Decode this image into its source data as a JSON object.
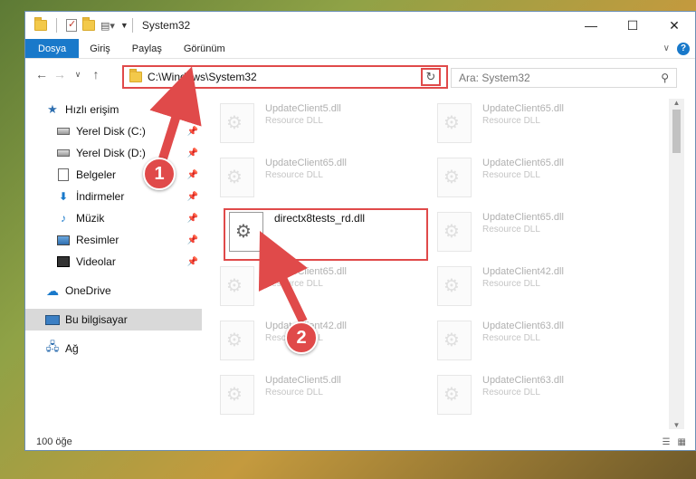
{
  "window": {
    "title": "System32"
  },
  "ribbon": {
    "tabs": [
      "Dosya",
      "Giriş",
      "Paylaş",
      "Görünüm"
    ]
  },
  "address": {
    "path": "C:\\Windows\\System32"
  },
  "search": {
    "placeholder": "Ara: System32"
  },
  "sidebar": {
    "quick_access": "Hızlı erişim",
    "items": [
      "Yerel Disk (C:)",
      "Yerel Disk (D:)",
      "Belgeler",
      "İndirmeler",
      "Müzik",
      "Resimler",
      "Videolar"
    ],
    "onedrive": "OneDrive",
    "this_pc": "Bu bilgisayar",
    "network": "Ağ"
  },
  "files": [
    {
      "name": "UpdateClient5.dll",
      "type": "Resource DLL"
    },
    {
      "name": "UpdateClient65.dll",
      "type": "Resource DLL"
    },
    {
      "name": "UpdateClient65.dll",
      "type": "Resource DLL"
    },
    {
      "name": "UpdateClient65.dll",
      "type": "Resource DLL"
    },
    {
      "name": "directx8tests_rd.dll",
      "type": ""
    },
    {
      "name": "UpdateClient65.dll",
      "type": "Resource DLL"
    },
    {
      "name": "UpdateClient65.dll",
      "type": "Resource DLL"
    },
    {
      "name": "UpdateClient42.dll",
      "type": "Resource DLL"
    },
    {
      "name": "UpdateClient42.dll",
      "type": "Resource DLL"
    },
    {
      "name": "UpdateClient63.dll",
      "type": "Resource DLL"
    },
    {
      "name": "UpdateClient5.dll",
      "type": "Resource DLL"
    },
    {
      "name": "UpdateClient63.dll",
      "type": "Resource DLL"
    }
  ],
  "status": {
    "count": "100 öğe"
  },
  "annotations": [
    "1",
    "2"
  ],
  "colors": {
    "accent": "#1979ca",
    "highlight": "#e04a4a"
  }
}
